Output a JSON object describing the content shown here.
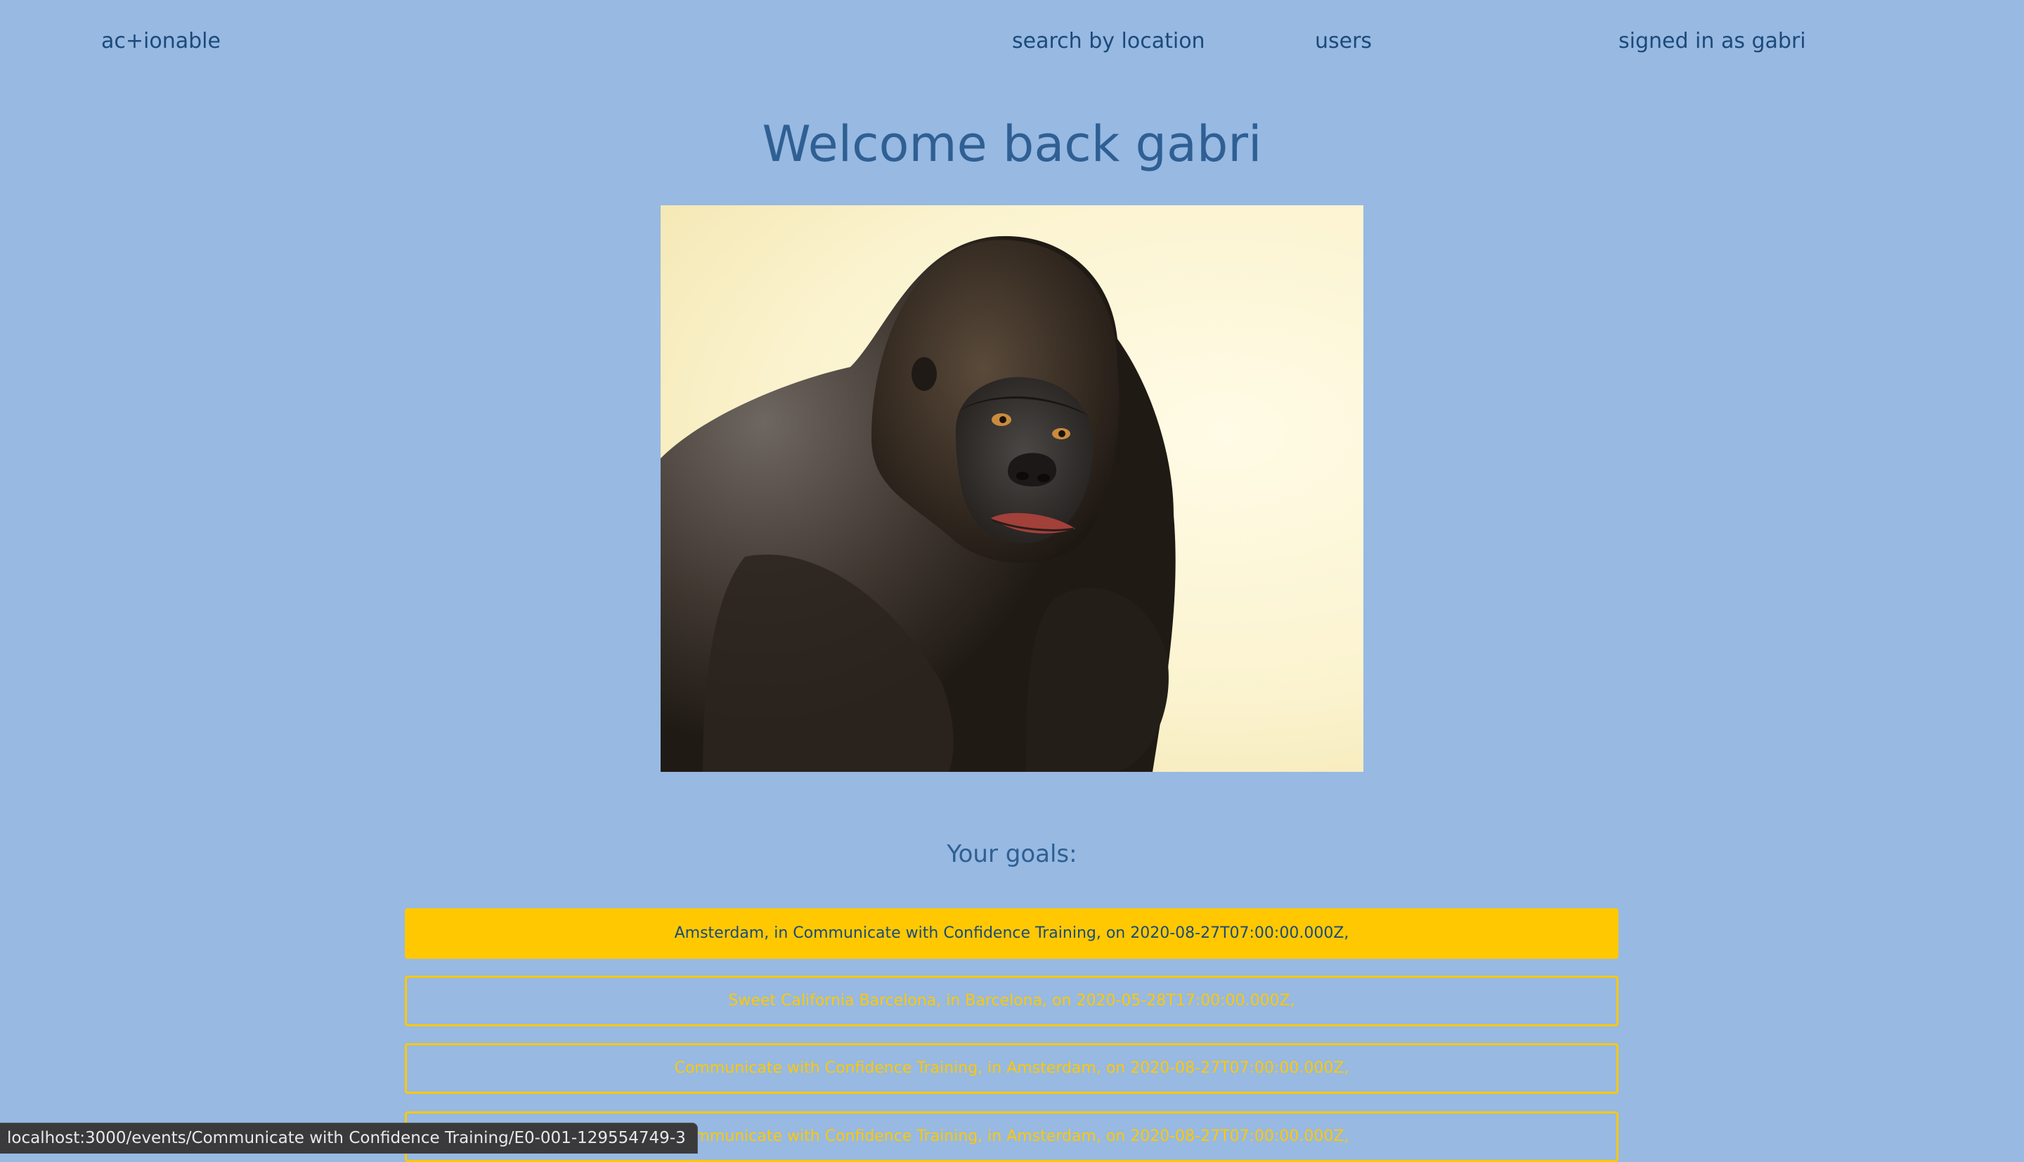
{
  "nav": {
    "brand": "ac+ionable",
    "search_link": "search by location",
    "users_link": "users",
    "signed_in": "signed in as gabri"
  },
  "main": {
    "title": "Welcome back gabri",
    "hero_image": "gorilla-portrait",
    "goals_label": "Your goals:",
    "goals": [
      "Amsterdam, in Communicate with Confidence Training, on 2020-08-27T07:00:00.000Z,",
      "Sweet California Barcelona, in Barcelona, on 2020-05-28T17:00:00.000Z,",
      "Communicate with Confidence Training, in Amsterdam, on 2020-08-27T07:00:00.000Z,",
      "Communicate with Confidence Training, in Amsterdam, on 2020-08-27T07:00:00.000Z,"
    ]
  },
  "status_bar": {
    "url": "localhost:3000/events/Communicate with Confidence Training/E0-001-129554749-3"
  },
  "colors": {
    "background": "#97b9e2",
    "accent": "#ffc800",
    "text": "#1c4a7a"
  }
}
